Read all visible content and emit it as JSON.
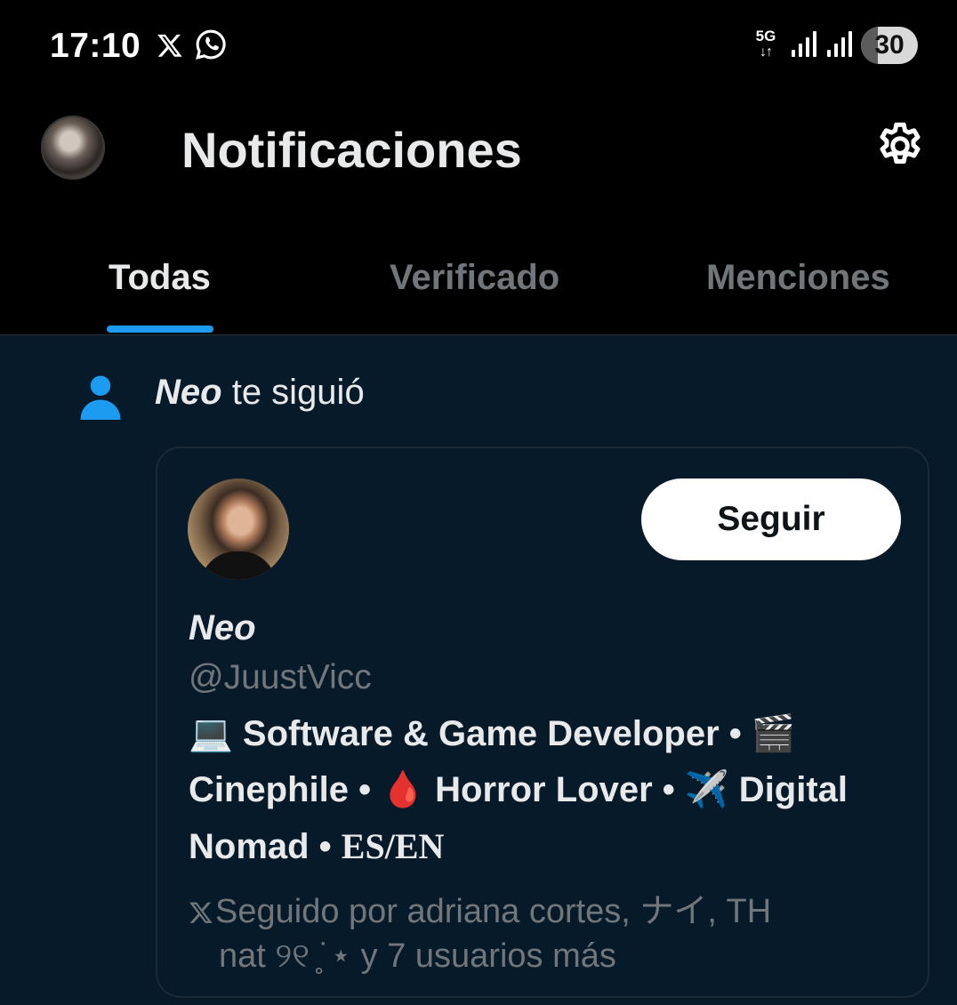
{
  "status_bar": {
    "time": "17:10",
    "network": "5G",
    "battery": "30",
    "battery_level": 0.3
  },
  "header": {
    "title": "Notificaciones"
  },
  "tabs": [
    {
      "label": "Todas",
      "active": true
    },
    {
      "label": "Verificado",
      "active": false
    },
    {
      "label": "Menciones",
      "active": false
    }
  ],
  "notification": {
    "actor": "Neo",
    "action": "te siguió",
    "card": {
      "name": "Neo",
      "handle": "@JuustVicc",
      "follow_label": "Seguir",
      "bio": {
        "seg1": "💻 Software & Game Developer • 🎬 Cinephile • 🩸 Horror Lover • ✈️ Digital Nomad • ",
        "seg2": "ES/EN"
      },
      "followed_by": {
        "line1": "Seguido por adriana cortes, ナイ, TH",
        "line2": "nat ୨୧ ̥˙⋆ y 7 usuarios más"
      }
    }
  },
  "colors": {
    "background": "#000000",
    "content_bg": "#071a29",
    "accent": "#1d9bf0",
    "muted": "#71767b",
    "text": "#e7e9ea"
  },
  "icons": [
    "x-logo-icon",
    "whatsapp-icon",
    "signal-icon",
    "battery-icon",
    "gear-icon",
    "person-icon"
  ]
}
